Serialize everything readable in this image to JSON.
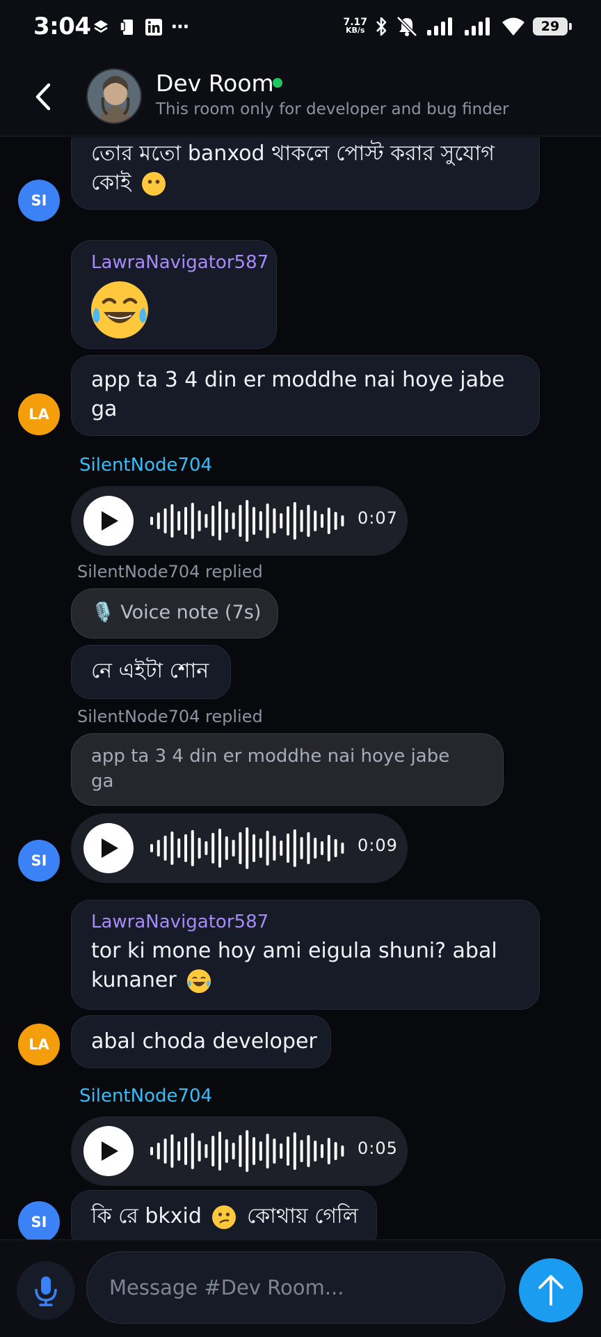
{
  "status_bar": {
    "time": "3:04",
    "net_speed_value": "7.17",
    "net_speed_unit": "KB/s",
    "battery": "29",
    "more": "⋯"
  },
  "header": {
    "title": "Dev Room",
    "description": "This room only for developer and bug finder",
    "online_color": "#22c55e"
  },
  "messages": [
    {
      "type": "text",
      "avatar": "SI",
      "text": "তোর মতো banxod থাকলে পোস্ট করার সুযোগ",
      "text2": "কোই"
    },
    {
      "type": "emoji",
      "sender": "LawraNavigator587",
      "emoji": "face-with-tears-of-joy"
    },
    {
      "type": "text",
      "avatar": "LA",
      "text": "app ta 3 4 din er moddhe nai hoye jabe",
      "text2": "ga"
    },
    {
      "type": "voice",
      "sender": "SilentNode704",
      "duration": "0:07"
    },
    {
      "type": "reply",
      "replied_label": "SilentNode704 replied",
      "quote": "🎙️ Voice note (7s)",
      "text": "নে এইটা শোন"
    },
    {
      "type": "reply-voice",
      "avatar": "SI",
      "replied_label": "SilentNode704 replied",
      "quote": "app ta 3 4 din er moddhe nai hoye jabe",
      "quote2": "ga",
      "duration": "0:09"
    },
    {
      "type": "text",
      "sender": "LawraNavigator587",
      "text": "tor ki mone hoy ami eigula shuni? abal",
      "text2": "kunaner"
    },
    {
      "type": "text",
      "avatar": "LA",
      "text": "abal choda developer"
    },
    {
      "type": "voice",
      "sender": "SilentNode704",
      "duration": "0:05"
    },
    {
      "type": "text",
      "avatar": "SI",
      "text": "কি রে bkxid",
      "text_after": "কোথায় গেলি"
    }
  ],
  "composer": {
    "placeholder": "Message #Dev Room..."
  },
  "colors": {
    "background": "#08090d",
    "bubble": "#171a27",
    "sender_purple": "#a78bfa",
    "sender_blue": "#38bdf8",
    "avatar_si": "#3b82f6",
    "avatar_la": "#f59e0b",
    "send": "#1a9cf0"
  }
}
